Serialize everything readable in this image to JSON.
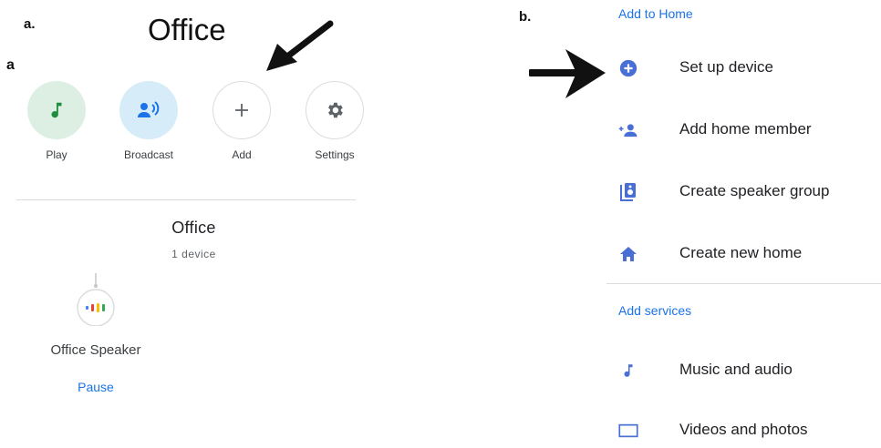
{
  "labels": {
    "panel_a": "a.",
    "panel_a_sub": "a",
    "panel_b": "b."
  },
  "home": {
    "title": "Office",
    "actions": [
      {
        "label": "Play",
        "icon": "music-note-icon"
      },
      {
        "label": "Broadcast",
        "icon": "broadcast-icon"
      },
      {
        "label": "Add",
        "icon": "plus-icon"
      },
      {
        "label": "Settings",
        "icon": "gear-icon"
      }
    ],
    "room": {
      "name": "Office",
      "device_count": "1 device"
    },
    "device": {
      "name": "Office Speaker",
      "action": "Pause",
      "icon": "speaker-icon"
    }
  },
  "menu": {
    "add_to_home": {
      "heading": "Add to Home",
      "items": [
        {
          "label": "Set up device",
          "icon": "add-circle-icon"
        },
        {
          "label": "Add home member",
          "icon": "add-person-icon"
        },
        {
          "label": "Create speaker group",
          "icon": "speaker-group-icon"
        },
        {
          "label": "Create new home",
          "icon": "home-icon"
        }
      ]
    },
    "add_services": {
      "heading": "Add services",
      "items": [
        {
          "label": "Music and audio",
          "icon": "music-note-icon"
        },
        {
          "label": "Videos and photos",
          "icon": "video-icon"
        }
      ]
    }
  },
  "colors": {
    "accent": "#1a73e8",
    "play_green": "#1e8e3e",
    "icon_blue": "#4a6fd4"
  }
}
